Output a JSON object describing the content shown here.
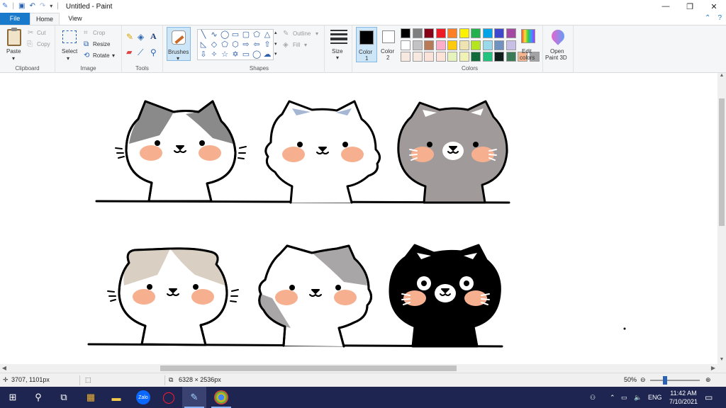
{
  "window": {
    "title": "Untitled - Paint",
    "controls": [
      "minimize-icon",
      "restore-icon",
      "close-icon"
    ]
  },
  "menu": {
    "tabs": [
      {
        "label": "File"
      },
      {
        "label": "Home"
      },
      {
        "label": "View"
      }
    ]
  },
  "ribbon": {
    "clipboard": {
      "paste": "Paste",
      "cut": "Cut",
      "copy": "Copy",
      "group": "Clipboard"
    },
    "image": {
      "select": "Select",
      "crop": "Crop",
      "resize": "Resize",
      "rotate": "Rotate",
      "group": "Image"
    },
    "tools": {
      "group": "Tools",
      "text_tool": "A"
    },
    "brushes": {
      "label": "Brushes"
    },
    "shapes": {
      "outline": "Outline",
      "fill": "Fill",
      "group": "Shapes"
    },
    "size": {
      "label": "Size"
    },
    "colors": {
      "color1_label": "Color",
      "color1_num": "1",
      "color2_label": "Color",
      "color2_num": "2",
      "color1": "#000000",
      "color2": "#ffffff",
      "palette_row1": [
        "#000000",
        "#7f7f7f",
        "#880015",
        "#ed1c24",
        "#ff7f27",
        "#fff200",
        "#22b14c",
        "#00a2e8",
        "#3f48cc",
        "#a349a4"
      ],
      "palette_row2": [
        "#ffffff",
        "#c3c3c3",
        "#b97a57",
        "#ffaec9",
        "#ffc90e",
        "#efe4b0",
        "#b5e61d",
        "#99d9ea",
        "#7092be",
        "#c8bfe7"
      ],
      "palette_row3": [
        "#f7e9df",
        "#f7e9df",
        "#fbe3d9",
        "#fbe3d9",
        "#e7f3bd",
        "#f2f2b6",
        "#0f6b3a",
        "#23c27d",
        "#0f1f1a",
        "#3a7a57",
        "#f7b68f",
        "#a3a3a3"
      ],
      "edit_colors_line1": "Edit",
      "edit_colors_line2": "colors",
      "group": "Colors"
    },
    "paint3d": {
      "line1": "Open",
      "line2": "Paint 3D"
    }
  },
  "canvas": {
    "cats_row1": [
      {
        "name": "gray-white-cat",
        "patch": "#8a8a8a",
        "ear_inner": "#8a8a8a"
      },
      {
        "name": "white-cat",
        "patch": "#ffffff",
        "ear_inner": "#a6b7d4"
      },
      {
        "name": "gray-cat",
        "patch": "#a09b9a",
        "ear_inner": "#ffffff"
      }
    ],
    "cats_row2": [
      {
        "name": "beige-white-cat",
        "patch": "#d9d0c3"
      },
      {
        "name": "calico-white-cat",
        "patch": "#a9a6a8"
      },
      {
        "name": "black-cat",
        "patch": "#000000"
      }
    ],
    "cheek_color": "#f7b08f"
  },
  "status": {
    "cursor_pos": "3707, 1101px",
    "image_size": "6328 × 2536px",
    "zoom": "50%"
  },
  "taskbar": {
    "language": "ENG",
    "time": "11:42 AM",
    "date": "7/10/2021",
    "apps": [
      "windows-start-icon",
      "search-icon",
      "task-view-icon",
      "app-store-icon",
      "file-explorer-icon",
      "zalo-icon",
      "opera-icon",
      "paint-icon",
      "chrome-icon"
    ]
  }
}
